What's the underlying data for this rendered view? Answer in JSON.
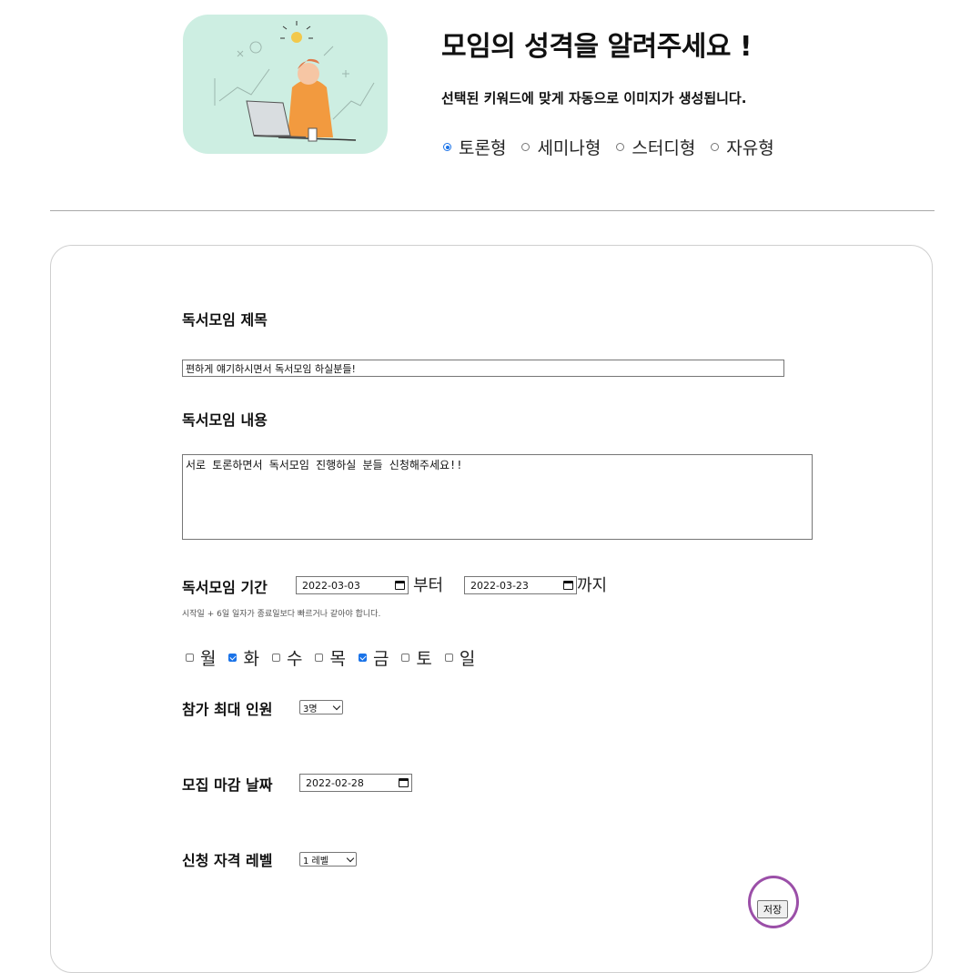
{
  "header": {
    "title": "모임의 성격을 알려주세요 !",
    "subtitle": "선택된 키워드에 맞게 자동으로 이미지가 생성됩니다.",
    "types": [
      {
        "label": "토론형",
        "checked": true
      },
      {
        "label": "세미나형",
        "checked": false
      },
      {
        "label": "스터디형",
        "checked": false
      },
      {
        "label": "자유형",
        "checked": false
      }
    ]
  },
  "form": {
    "title_label": "독서모임 제목",
    "title_value": "편하게 얘기하시면서 독서모임 하실분들!",
    "content_label": "독서모임 내용",
    "content_value": "서로 토론하면서 독서모임 진행하실 분들 신청해주세요!!",
    "period_label": "독서모임 기간",
    "start_date": "2022-03-03",
    "from_text": "부터",
    "end_date": "2022-03-23",
    "until_text": "까지",
    "period_hint": "시작일 + 6일 일자가 종료일보다 빠르거나 같아야 합니다.",
    "days": [
      {
        "label": "월",
        "checked": false
      },
      {
        "label": "화",
        "checked": true
      },
      {
        "label": "수",
        "checked": false
      },
      {
        "label": "목",
        "checked": false
      },
      {
        "label": "금",
        "checked": true
      },
      {
        "label": "토",
        "checked": false
      },
      {
        "label": "일",
        "checked": false
      }
    ],
    "max_label": "참가 최대 인원",
    "max_value": "3명",
    "deadline_label": "모집 마감 날짜",
    "deadline_value": "2022-02-28",
    "level_label": "신청 자격 레벨",
    "level_value": "1 레벨",
    "save_label": "저장"
  },
  "colors": {
    "illustration_bg": "#cdeee2",
    "accent": "#1a73e8",
    "highlight_ring": "#9b4fa8"
  }
}
